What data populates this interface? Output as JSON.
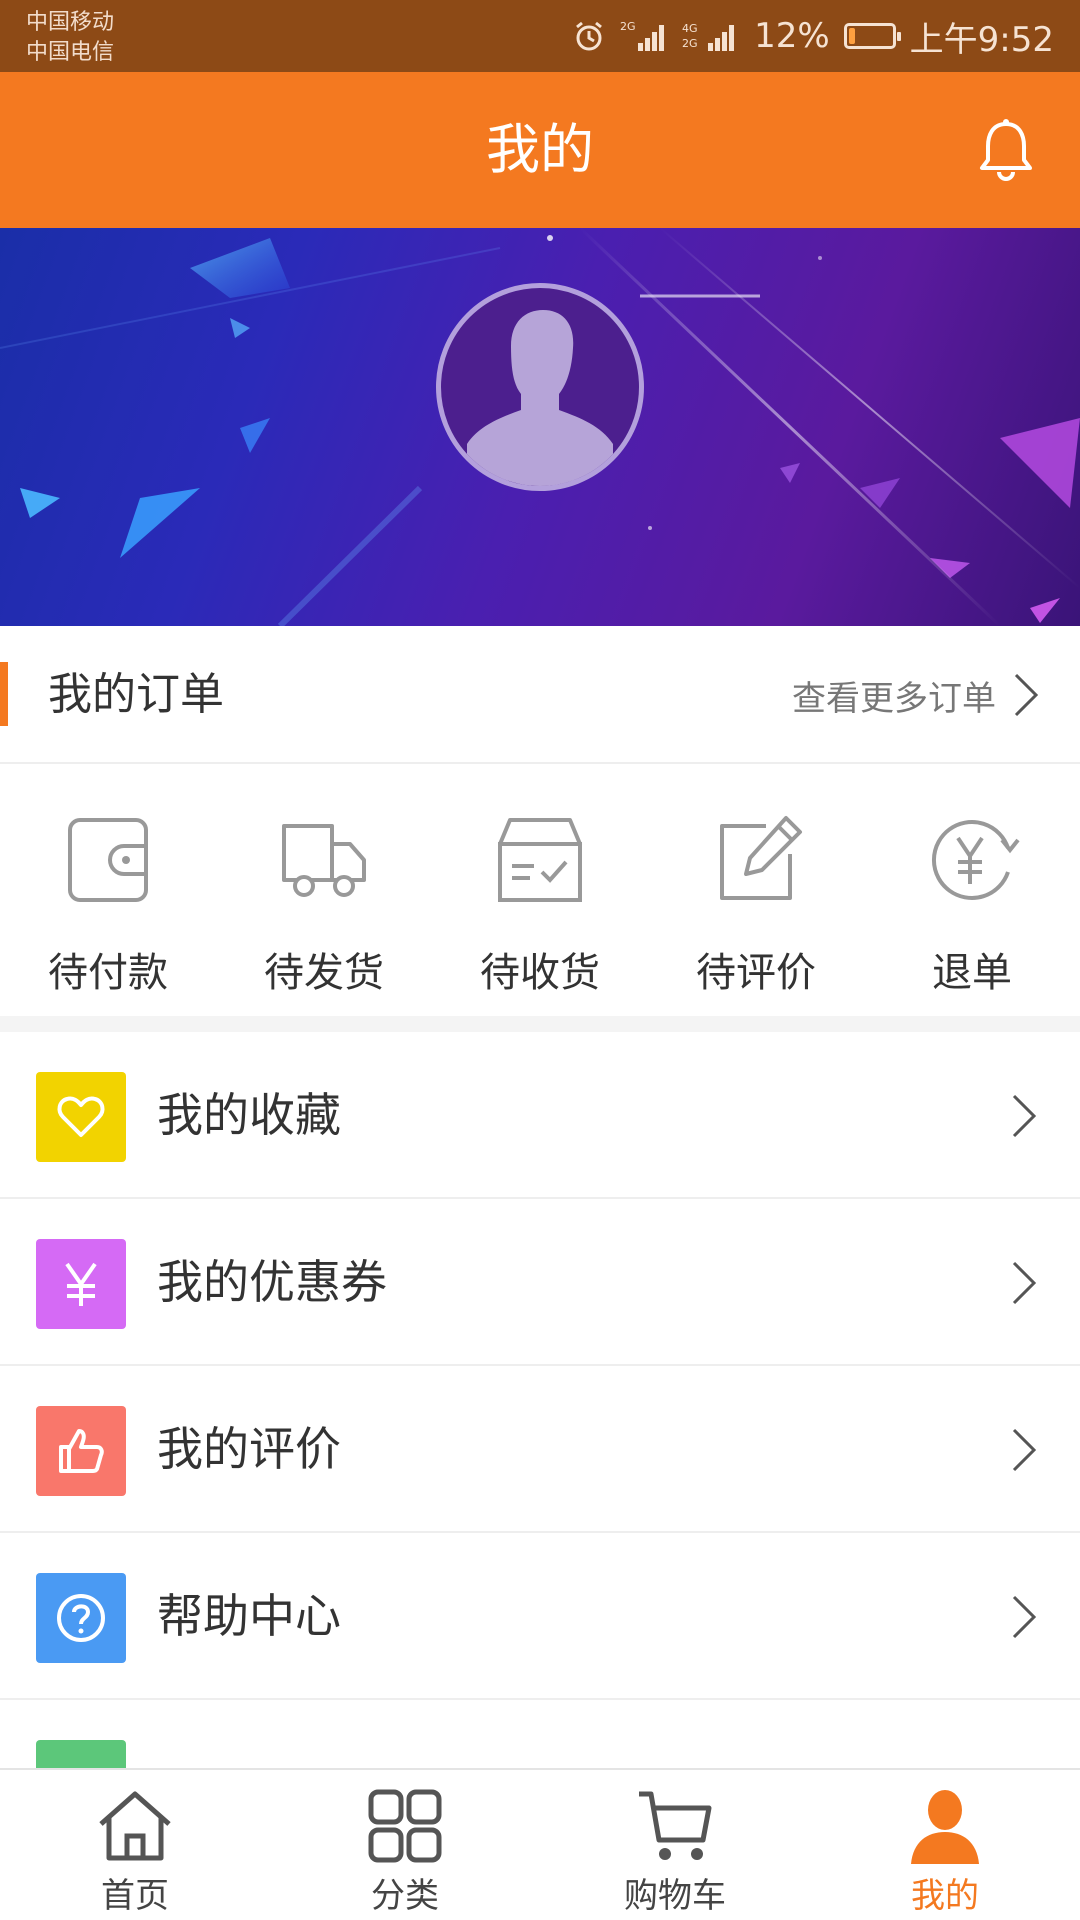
{
  "status_bar": {
    "carrier_1": "中国移动",
    "carrier_2": "中国电信",
    "battery_text": "12%",
    "battery_level": 0.12,
    "time": "上午9:52",
    "icons": [
      "alarm-icon",
      "signal-2g-icon",
      "signal-4g-icon",
      "battery-icon"
    ]
  },
  "header": {
    "title": "我的",
    "notification_icon": "bell-icon",
    "color": "#f47920"
  },
  "profile": {
    "avatar_icon": "default-avatar-icon"
  },
  "orders": {
    "title": "我的订单",
    "more_label": "查看更多订单",
    "items": [
      {
        "label": "待付款",
        "icon": "wallet-icon"
      },
      {
        "label": "待发货",
        "icon": "truck-icon"
      },
      {
        "label": "待收货",
        "icon": "box-icon"
      },
      {
        "label": "待评价",
        "icon": "edit-icon"
      },
      {
        "label": "退单",
        "icon": "refund-icon"
      }
    ]
  },
  "menu": {
    "items": [
      {
        "label": "我的收藏",
        "icon": "heart-icon",
        "color": "#f2d300"
      },
      {
        "label": "我的优惠券",
        "icon": "yen-icon",
        "color": "#d56af5"
      },
      {
        "label": "我的评价",
        "icon": "thumbs-up-icon",
        "color": "#f9776b"
      },
      {
        "label": "帮助中心",
        "icon": "question-icon",
        "color": "#4a9af3"
      }
    ]
  },
  "tabbar": {
    "items": [
      {
        "label": "首页",
        "icon": "home-icon"
      },
      {
        "label": "分类",
        "icon": "grid-icon"
      },
      {
        "label": "购物车",
        "icon": "cart-icon"
      },
      {
        "label": "我的",
        "icon": "user-icon",
        "active": true
      }
    ],
    "active_color": "#f47920"
  }
}
